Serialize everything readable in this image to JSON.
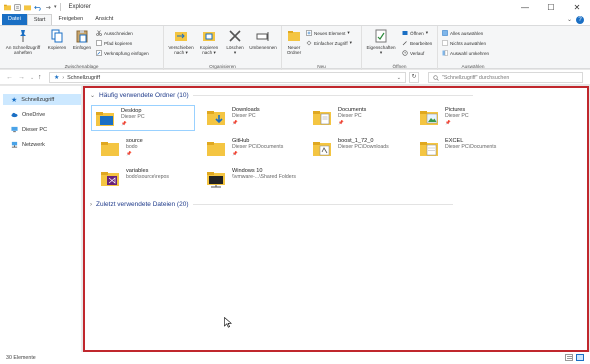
{
  "window": {
    "title": "Explorer",
    "controls": [
      "—",
      "☐",
      "✕"
    ]
  },
  "ribbon_tabs": [
    {
      "label": "Datei"
    },
    {
      "label": "Start"
    },
    {
      "label": "Freigeben"
    },
    {
      "label": "Ansicht"
    }
  ],
  "ribbon": {
    "clipboard": {
      "pin_label_1": "An Schnellzugriff",
      "pin_label_2": "anheften",
      "copy": "Kopieren",
      "paste": "Einfügen",
      "cut": "Ausschneiden",
      "copy_path": "Pfad kopieren",
      "paste_shortcut": "Verknüpfung einfügen",
      "group": "Zwischenablage"
    },
    "organize": {
      "move_1": "Verschieben",
      "move_2": "nach",
      "copyto_1": "Kopieren",
      "copyto_2": "nach",
      "delete": "Löschen",
      "rename": "Umbenennen",
      "group": "Organisieren"
    },
    "new": {
      "new_folder_1": "Neuer",
      "new_folder_2": "Ordner",
      "new_item": "Neues Element",
      "easy_access": "Einfacher Zugriff",
      "group": "Neu"
    },
    "open": {
      "properties": "Eigenschaften",
      "open": "Öffnen",
      "edit": "Bearbeiten",
      "history": "Verlauf",
      "group": "Öffnen"
    },
    "select": {
      "select_all": "Alles auswählen",
      "select_none": "Nichts auswählen",
      "invert": "Auswahl umkehren",
      "group": "Auswählen"
    }
  },
  "address": {
    "crumb": "Schnellzugriff",
    "search_placeholder": "\"Schnellzugriff\" durchsuchen"
  },
  "nav": [
    {
      "label": "Schnellzugriff",
      "icon": "star-icon"
    },
    {
      "label": "OneDrive",
      "icon": "cloud-icon"
    },
    {
      "label": "Dieser PC",
      "icon": "pc-icon"
    },
    {
      "label": "Netzwerk",
      "icon": "network-icon"
    }
  ],
  "frequent": {
    "header": "Häufig verwendete Ordner (10)",
    "items": [
      {
        "name": "Desktop",
        "path": "Dieser PC",
        "pinned": true,
        "kind": "desktop"
      },
      {
        "name": "Downloads",
        "path": "Dieser PC",
        "pinned": true,
        "kind": "downloads"
      },
      {
        "name": "Documents",
        "path": "Dieser PC",
        "pinned": true,
        "kind": "documents"
      },
      {
        "name": "Pictures",
        "path": "Dieser PC",
        "pinned": true,
        "kind": "pictures"
      },
      {
        "name": "source",
        "path": "bodo",
        "pinned": true,
        "kind": "folder"
      },
      {
        "name": "GitHub",
        "path": "Dieser PC\\Documents",
        "pinned": true,
        "kind": "folder"
      },
      {
        "name": "boost_1_72_0",
        "path": "Dieser PC\\Downloads",
        "pinned": false,
        "kind": "boost"
      },
      {
        "name": "EXCEL",
        "path": "Dieser PC\\Documents",
        "pinned": false,
        "kind": "excel"
      },
      {
        "name": "variables",
        "path": "bodo\\source\\repos",
        "pinned": false,
        "kind": "vs"
      },
      {
        "name": "Windows 10",
        "path": "\\\\vmware-...\\Shared Folders",
        "pinned": false,
        "kind": "win10"
      }
    ]
  },
  "recent": {
    "header": "Zuletzt verwendete Dateien (20)"
  },
  "status": {
    "count": "30 Elemente"
  },
  "colors": {
    "accent": "#1a6fc4",
    "highlight_border": "#c0272d",
    "folder_yellow": "#f4c542",
    "selection": "#cce8ff"
  }
}
